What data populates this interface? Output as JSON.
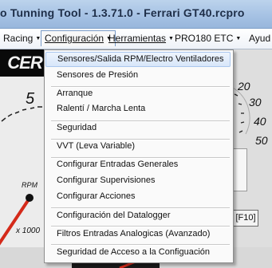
{
  "window": {
    "title": "o Tunning Tool - 1.3.71.0 - Ferrari GT40.rcpro"
  },
  "menubar": {
    "racing": "Racing",
    "configuracion": "Configuración",
    "herramientas": "Herramientas",
    "pro180": "PRO180 ETC",
    "ayuda": "Ayud"
  },
  "dropdown_items": [
    "Sensores/Salida RPM/Electro Ventiladores",
    "Sensores de Presión",
    "Arranque",
    "Ralentí / Marcha Lenta",
    "Seguridad",
    "VVT (Leva Variable)",
    "Configurar Entradas Generales",
    "Configurar Supervisiones",
    "Configurar Acciones",
    "Configuración del Datalogger",
    "Filtros Entradas Analogicas (Avanzado)",
    "Seguridad de Acceso a la Configuación"
  ],
  "logo": {
    "main": "CER",
    "accent": ""
  },
  "gauge": {
    "tick_5": "5",
    "rpm_label": "RPM",
    "multiplier": "x 1000"
  },
  "right_gauge": {
    "ticks": [
      "20",
      "30",
      "40",
      "50"
    ]
  },
  "button_f10": "[F10]",
  "colors": {
    "highlight": "#d7e6f9",
    "needle_red": "#d42a1a",
    "titlebar": "#a6c2e4"
  }
}
